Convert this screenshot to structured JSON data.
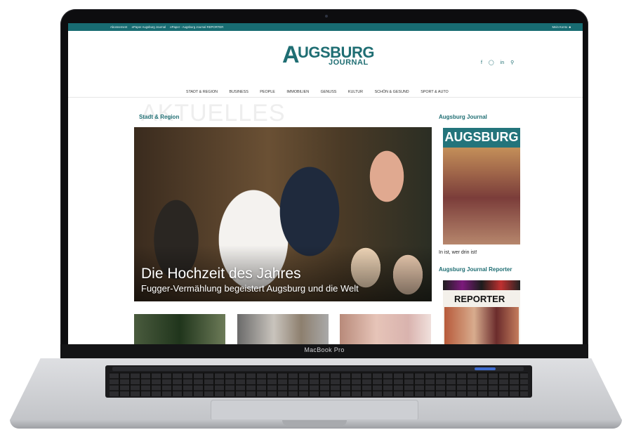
{
  "device": {
    "label": "MacBook Pro"
  },
  "topbar": {
    "links": [
      "Abonnement",
      "ePaper Augsburg Journal",
      "ePaper - Augsburg Journal REPORTER"
    ],
    "login": "Mein Konto"
  },
  "logo": {
    "letter": "A",
    "main": "UGSBURG",
    "sub": "JOURNAL"
  },
  "social_icons": [
    "facebook-icon",
    "instagram-icon",
    "linkedin-icon",
    "search-icon"
  ],
  "nav": {
    "items": [
      "STADT & REGION",
      "BUSINESS",
      "PEOPLE",
      "IMMOBILIEN",
      "GENUSS",
      "KULTUR",
      "SCHÖN & GESUND",
      "SPORT & AUTO"
    ]
  },
  "main": {
    "section_watermark": "AKTUELLES",
    "section_label": "Stadt & Region",
    "hero": {
      "title": "Die Hochzeit des Jahres",
      "subtitle": "Fugger-Vermählung begeistert Augsburg und die Welt"
    }
  },
  "sidebar": {
    "journal_heading": "Augsburg Journal",
    "magazine_title": "AUGSBURG",
    "magazine_note": "In ist, wer drin ist!",
    "reporter_heading": "Augsburg Journal Reporter",
    "reporter_title": "REPORTER"
  },
  "colors": {
    "brand": "#1f6e73",
    "topbar": "#186c72"
  }
}
